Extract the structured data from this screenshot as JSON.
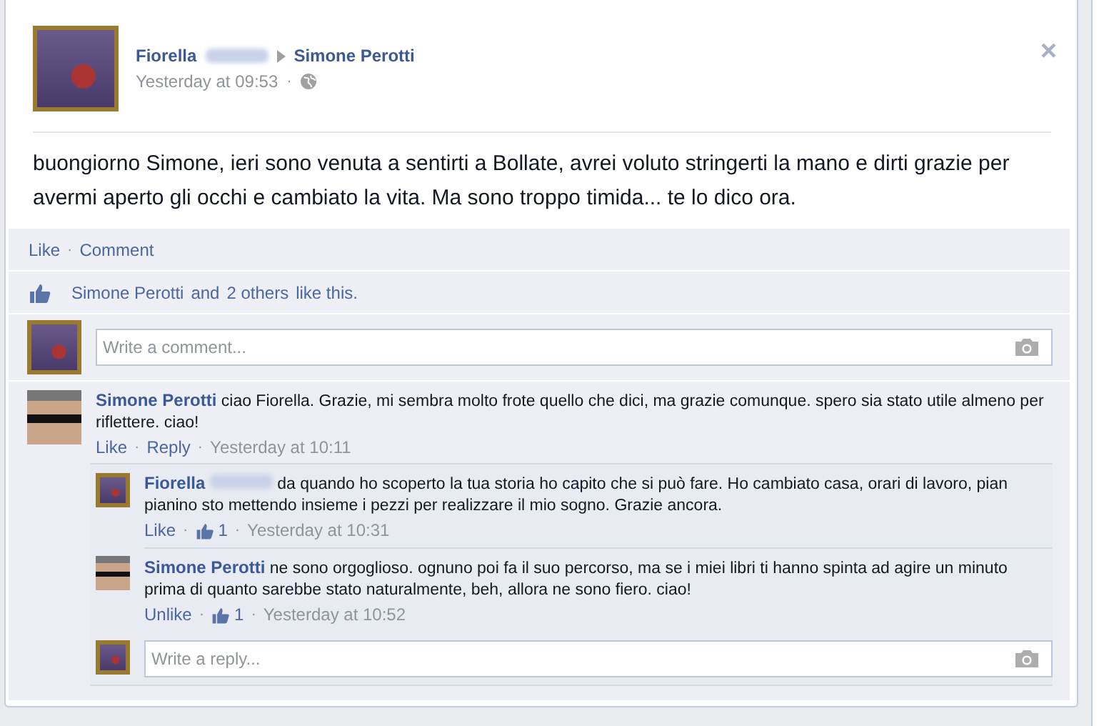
{
  "post": {
    "author": "Fiorella",
    "target": "Simone Perotti",
    "time": "Yesterday at 09:53",
    "separator": "·",
    "close": "×",
    "text": "buongiorno Simone, ieri sono venuta a sentirti a Bollate, avrei voluto stringerti la mano e dirti grazie per avermi aperto gli occhi e cambiato la vita. Ma sono troppo timida... te lo dico ora.",
    "actions": [
      "Like",
      "Comment"
    ],
    "likes": {
      "name": "Simone Perotti",
      "middle": "and",
      "others": "2 others",
      "end": "like this."
    },
    "composer": {
      "placeholder": "Write a comment..."
    },
    "comments": [
      {
        "author": "Simone Perotti",
        "author_blurred": false,
        "text": "ciao Fiorella. Grazie, mi sembra molto frote quello che dici, ma grazie comunque. spero sia stato utile almeno per riflettere. ciao!",
        "actions": [
          "Like",
          "Reply"
        ],
        "time": "Yesterday at 10:11",
        "replies": [
          {
            "author": "Fiorella",
            "author_blurred": true,
            "text": "da quando ho scoperto la tua storia ho capito che si può fare. Ho cambiato casa, orari di lavoro, pian pianino sto mettendo insieme i pezzi per realizzare il mio sogno. Grazie ancora.",
            "actions": [
              "Like"
            ],
            "like_count": "1",
            "time": "Yesterday at 10:31"
          },
          {
            "author": "Simone Perotti",
            "author_blurred": false,
            "text": "ne sono orgoglioso. ognuno poi fa il suo percorso, ma se i miei libri ti hanno spinta ad agire un minuto prima di quanto sarebbe stato naturalmente, beh, allora ne sono fiero. ciao!",
            "actions": [
              "Unlike"
            ],
            "like_count": "1",
            "time": "Yesterday at 10:52"
          }
        ],
        "reply_composer": {
          "placeholder": "Write a reply..."
        }
      }
    ]
  }
}
